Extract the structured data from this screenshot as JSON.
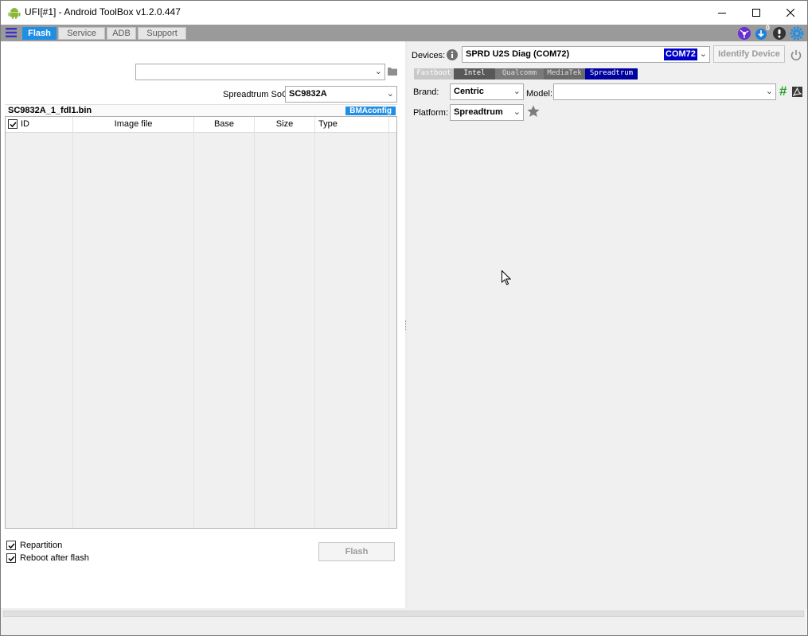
{
  "window": {
    "title": "UFI[#1] - Android ToolBox v1.2.0.447"
  },
  "menubar": {
    "tabs": [
      {
        "label": "Flash"
      },
      {
        "label": "Service"
      },
      {
        "label": "ADB"
      },
      {
        "label": "Support"
      }
    ],
    "icons": [
      "network-icon",
      "download-icon",
      "info-icon",
      "gear-icon"
    ],
    "download_badge": "0"
  },
  "devices": {
    "label": "Devices:",
    "value": "SPRD U2S Diag (COM72)",
    "port": "COM72",
    "identify_button": "Identify Device"
  },
  "platform_tabs": [
    "Fastboot",
    "Intel",
    "Qualcomm",
    "MediaTek",
    "Spreadtrum"
  ],
  "brand": {
    "label": "Brand:",
    "value": "Centric"
  },
  "model": {
    "label": "Model:",
    "value": ""
  },
  "platform": {
    "label": "Platform:",
    "value": "Spreadtrum"
  },
  "firmware_path": {
    "value": ""
  },
  "soc": {
    "label": "Spreadtrum SoC:",
    "value": "SC9832A"
  },
  "fdl": {
    "filename": "SC9832A_1_fdl1.bin",
    "config_button": "BMAconfig"
  },
  "table": {
    "columns": [
      "ID",
      "Image file",
      "Base",
      "Size",
      "Type"
    ],
    "rows": []
  },
  "options": {
    "repartition": {
      "label": "Repartition",
      "checked": true
    },
    "reboot": {
      "label": "Reboot after flash",
      "checked": true
    }
  },
  "flash_button": "Flash",
  "colors": {
    "accent": "#1f8fe6",
    "menubar": "#9a9a9a",
    "spreadtrum_tab": "#0000a0",
    "port_highlight": "#0000c8",
    "hash_green": "#2aa52a"
  }
}
